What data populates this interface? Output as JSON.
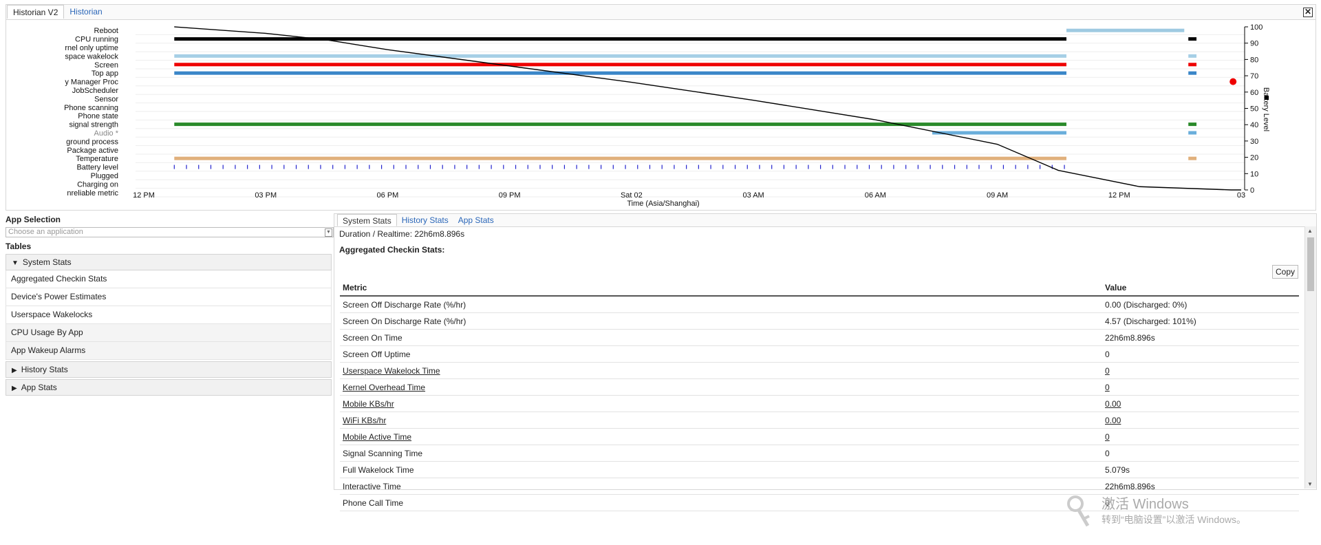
{
  "window": {
    "tabs": [
      "Historian V2",
      "Historian"
    ],
    "close_icon": "close-icon"
  },
  "chart_data": {
    "type": "timeline",
    "row_labels": [
      "Reboot",
      "CPU running",
      "rnel only uptime",
      "space wakelock",
      "Screen",
      "Top app",
      "y Manager Proc",
      "JobScheduler",
      "Sensor",
      "Phone scanning",
      "Phone state",
      "signal strength",
      "Audio *",
      "ground process",
      "Package active",
      "Temperature",
      "Battery level",
      "Plugged",
      "Charging on",
      "nreliable metric"
    ],
    "x_ticks": [
      "12 PM",
      "03 PM",
      "06 PM",
      "09 PM",
      "Sat 02",
      "03 AM",
      "06 AM",
      "09 AM",
      "12 PM",
      "03"
    ],
    "xlabel": "Time (Asia/Shanghai)",
    "y2_ticks": [
      "100",
      "90",
      "80",
      "70",
      "60",
      "50",
      "40",
      "30",
      "20",
      "10",
      "0"
    ],
    "y2label": "Battery Level",
    "y2lim": [
      0,
      100
    ],
    "battery_level": {
      "x_hours_from_first_tick": [
        0.75,
        3.0,
        4.5,
        6.0,
        9.0,
        12.0,
        15.0,
        18.0,
        21.0,
        22.5,
        24.5,
        26.75,
        27.0
      ],
      "values": [
        100,
        96,
        92,
        86,
        76,
        66,
        55,
        43,
        28,
        12,
        2,
        0,
        0
      ]
    },
    "bars": [
      {
        "row": "Reboot",
        "segments": [
          [
            22.7,
            25.6
          ]
        ],
        "color": "#9ecae1"
      },
      {
        "row": "CPU running",
        "segments": [
          [
            0.75,
            22.7
          ],
          [
            25.7,
            25.9
          ]
        ],
        "color": "#000000"
      },
      {
        "row": "space wakelock",
        "segments": [
          [
            0.75,
            22.7
          ],
          [
            25.7,
            25.9
          ]
        ],
        "color": "#a6cfe6"
      },
      {
        "row": "Screen",
        "segments": [
          [
            0.75,
            22.7
          ],
          [
            25.7,
            25.9
          ]
        ],
        "color": "#ee0000"
      },
      {
        "row": "Top app",
        "segments": [
          [
            0.75,
            22.7
          ],
          [
            25.7,
            25.9
          ]
        ],
        "color": "#3a86c8"
      },
      {
        "row": "signal strength",
        "segments": [
          [
            0.75,
            22.7
          ],
          [
            25.7,
            25.9
          ]
        ],
        "color": "#2a8a2a"
      },
      {
        "row": "Audio *",
        "segments": [
          [
            19.4,
            22.7
          ],
          [
            25.7,
            25.9
          ]
        ],
        "color": "#6aaedb"
      },
      {
        "row": "Temperature",
        "segments": [
          [
            0.75,
            22.7
          ],
          [
            25.7,
            25.9
          ]
        ],
        "color": "#e0b07c"
      }
    ]
  },
  "app_selection": {
    "title": "App Selection",
    "placeholder": "Choose an application"
  },
  "tables": {
    "title": "Tables",
    "system_stats_header": "System Stats",
    "system_items": [
      "Aggregated Checkin Stats",
      "Device's Power Estimates",
      "Userspace Wakelocks",
      "CPU Usage By App",
      "App Wakeup Alarms"
    ],
    "history_header": "History Stats",
    "app_header": "App Stats"
  },
  "stats": {
    "tabs": [
      "System Stats",
      "History Stats",
      "App Stats"
    ],
    "duration_label": "Duration / Realtime: 22h6m8.896s",
    "section_title": "Aggregated Checkin Stats:",
    "copy_label": "Copy",
    "columns": [
      "Metric",
      "Value"
    ],
    "rows": [
      {
        "metric": "Screen Off Discharge Rate (%/hr)",
        "value": "0.00 (Discharged: 0%)",
        "link": false
      },
      {
        "metric": "Screen On Discharge Rate (%/hr)",
        "value": "4.57 (Discharged: 101%)",
        "link": false
      },
      {
        "metric": "Screen On Time",
        "value": "22h6m8.896s",
        "link": false
      },
      {
        "metric": "Screen Off Uptime",
        "value": "0",
        "link": false
      },
      {
        "metric": "Userspace Wakelock Time",
        "value": "0",
        "link": true
      },
      {
        "metric": "Kernel Overhead Time",
        "value": "0",
        "link": true
      },
      {
        "metric": "Mobile KBs/hr",
        "value": "0.00",
        "link": true
      },
      {
        "metric": "WiFi KBs/hr",
        "value": "0.00",
        "link": true
      },
      {
        "metric": "Mobile Active Time",
        "value": "0",
        "link": true
      },
      {
        "metric": "Signal Scanning Time",
        "value": "0",
        "link": false
      },
      {
        "metric": "Full Wakelock Time",
        "value": "5.079s",
        "link": false
      },
      {
        "metric": "Interactive Time",
        "value": "22h6m8.896s",
        "link": false
      },
      {
        "metric": "Phone Call Time",
        "value": "0",
        "link": false
      }
    ]
  },
  "watermark": {
    "line1": "激活 Windows",
    "line2": "转到“电脑设置”以激活 Windows。"
  }
}
